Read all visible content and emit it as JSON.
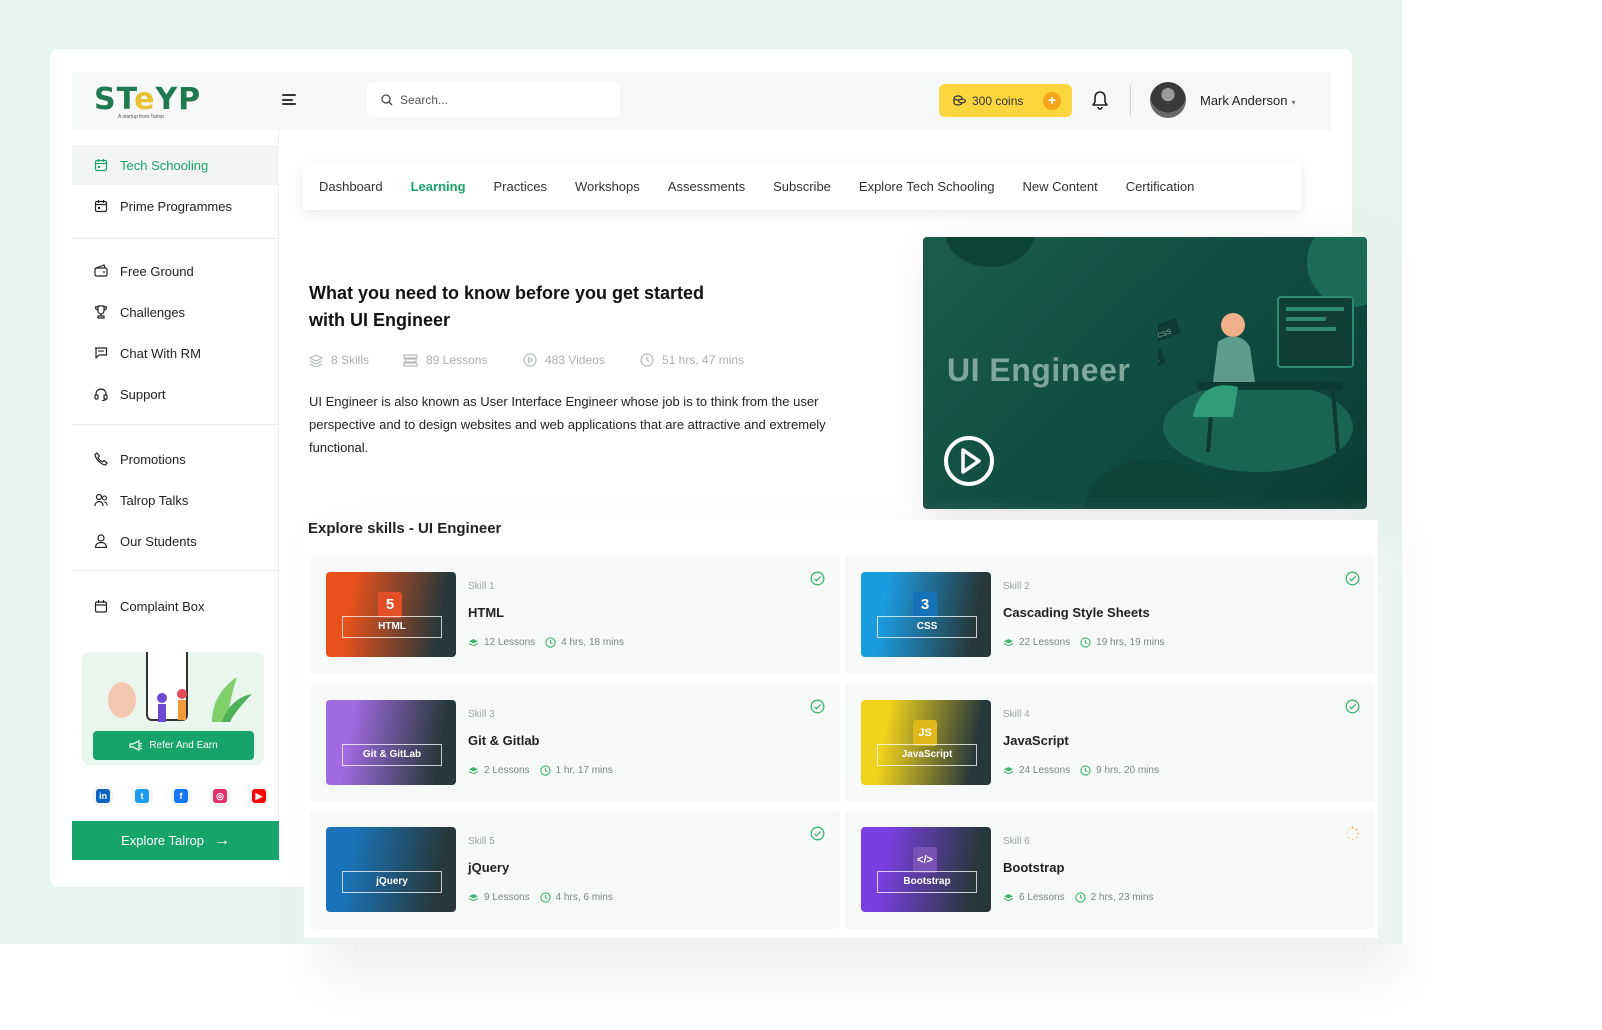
{
  "logo": {
    "brand_a": "ST",
    "brand_e": "e",
    "brand_b": "YP",
    "tagline": "A startup from Talrop"
  },
  "search": {
    "placeholder": "Search..."
  },
  "coins": {
    "label": "300 coins",
    "plus": "+"
  },
  "user": {
    "name": "Mark Anderson",
    "caret": "▾"
  },
  "sidebar": {
    "items": [
      {
        "label": "Tech Schooling",
        "icon": "calendar-icon",
        "active": true
      },
      {
        "label": "Prime Programmes",
        "icon": "calendar-icon"
      },
      {
        "label": "Free Ground",
        "icon": "wallet-icon"
      },
      {
        "label": "Challenges",
        "icon": "trophy-icon"
      },
      {
        "label": "Chat With RM",
        "icon": "chat-icon"
      },
      {
        "label": "Support",
        "icon": "headset-icon"
      },
      {
        "label": "Promotions",
        "icon": "phone-icon"
      },
      {
        "label": "Talrop Talks",
        "icon": "users-icon"
      },
      {
        "label": "Our Students",
        "icon": "user-icon"
      },
      {
        "label": "Complaint Box",
        "icon": "box-icon"
      }
    ],
    "refer_label": "Refer And Earn",
    "explore_label": "Explore Talrop",
    "explore_arrow": "→",
    "social": [
      {
        "name": "linkedin-icon",
        "glyph": "in",
        "color": "#0a66c2"
      },
      {
        "name": "twitter-icon",
        "glyph": "t",
        "color": "#1d9bf0"
      },
      {
        "name": "facebook-icon",
        "glyph": "f",
        "color": "#1877f2"
      },
      {
        "name": "instagram-icon",
        "glyph": "◎",
        "color": "#e1306c"
      },
      {
        "name": "youtube-icon",
        "glyph": "▶",
        "color": "#ff0000"
      }
    ]
  },
  "tabs": [
    "Dashboard",
    "Learning",
    "Practices",
    "Workshops",
    "Assessments",
    "Subscribe",
    "Explore Tech Schooling",
    "New Content",
    "Certification"
  ],
  "active_tab": "Learning",
  "intro": {
    "title": "What you need to know before you get started with UI Engineer",
    "skills": "8 Skills",
    "lessons": "89 Lessons",
    "videos": "483 Videos",
    "duration": "51 hrs, 47 mins",
    "description": "UI Engineer is also known as User Interface Engineer whose job is to think from the user perspective and to design websites and web applications that are attractive and extremely functional."
  },
  "video": {
    "title": "UI Engineer"
  },
  "skills_heading": "Explore skills - UI Engineer",
  "skills": [
    {
      "num": "Skill 1",
      "name": "HTML",
      "thumb_label": "HTML",
      "badge": "5",
      "lessons": "12 Lessons",
      "duration": "4 hrs, 18 mins",
      "status": "complete",
      "color": "#e8511c",
      "badge_color": "#e34f26"
    },
    {
      "num": "Skill 2",
      "name": "Cascading Style Sheets",
      "thumb_label": "CSS",
      "badge": "3",
      "lessons": "22 Lessons",
      "duration": "19 hrs, 19 mins",
      "status": "complete",
      "color": "#1b9be0",
      "badge_color": "#1572b6"
    },
    {
      "num": "Skill 3",
      "name": "Git & Gitlab",
      "thumb_label": "Git & GitLab",
      "badge": "",
      "lessons": "2 Lessons",
      "duration": "1 hr, 17 mins",
      "status": "complete",
      "color": "#a06ae0",
      "badge_color": "#fc6d26"
    },
    {
      "num": "Skill 4",
      "name": "JavaScript",
      "thumb_label": "JavaScript",
      "badge": "JS",
      "lessons": "24 Lessons",
      "duration": "9 hrs, 20 mins",
      "status": "complete",
      "color": "#f0d21c",
      "badge_color": "#e0b81a"
    },
    {
      "num": "Skill 5",
      "name": "jQuery",
      "thumb_label": "jQuery",
      "badge": "",
      "lessons": "9 Lessons",
      "duration": "4 hrs, 6 mins",
      "status": "complete",
      "color": "#1a73b8",
      "badge_color": "#0769ad"
    },
    {
      "num": "Skill 6",
      "name": "Bootstrap",
      "thumb_label": "Bootstrap",
      "badge": "</>",
      "lessons": "6 Lessons",
      "duration": "2 hrs, 23 mins",
      "status": "in-progress",
      "color": "#7a3fe0",
      "badge_color": "#7952b3"
    }
  ],
  "colors": {
    "accent": "#17a46a",
    "coin": "#fbd63f",
    "sidebar_active_bg": "#f3f4f4"
  }
}
